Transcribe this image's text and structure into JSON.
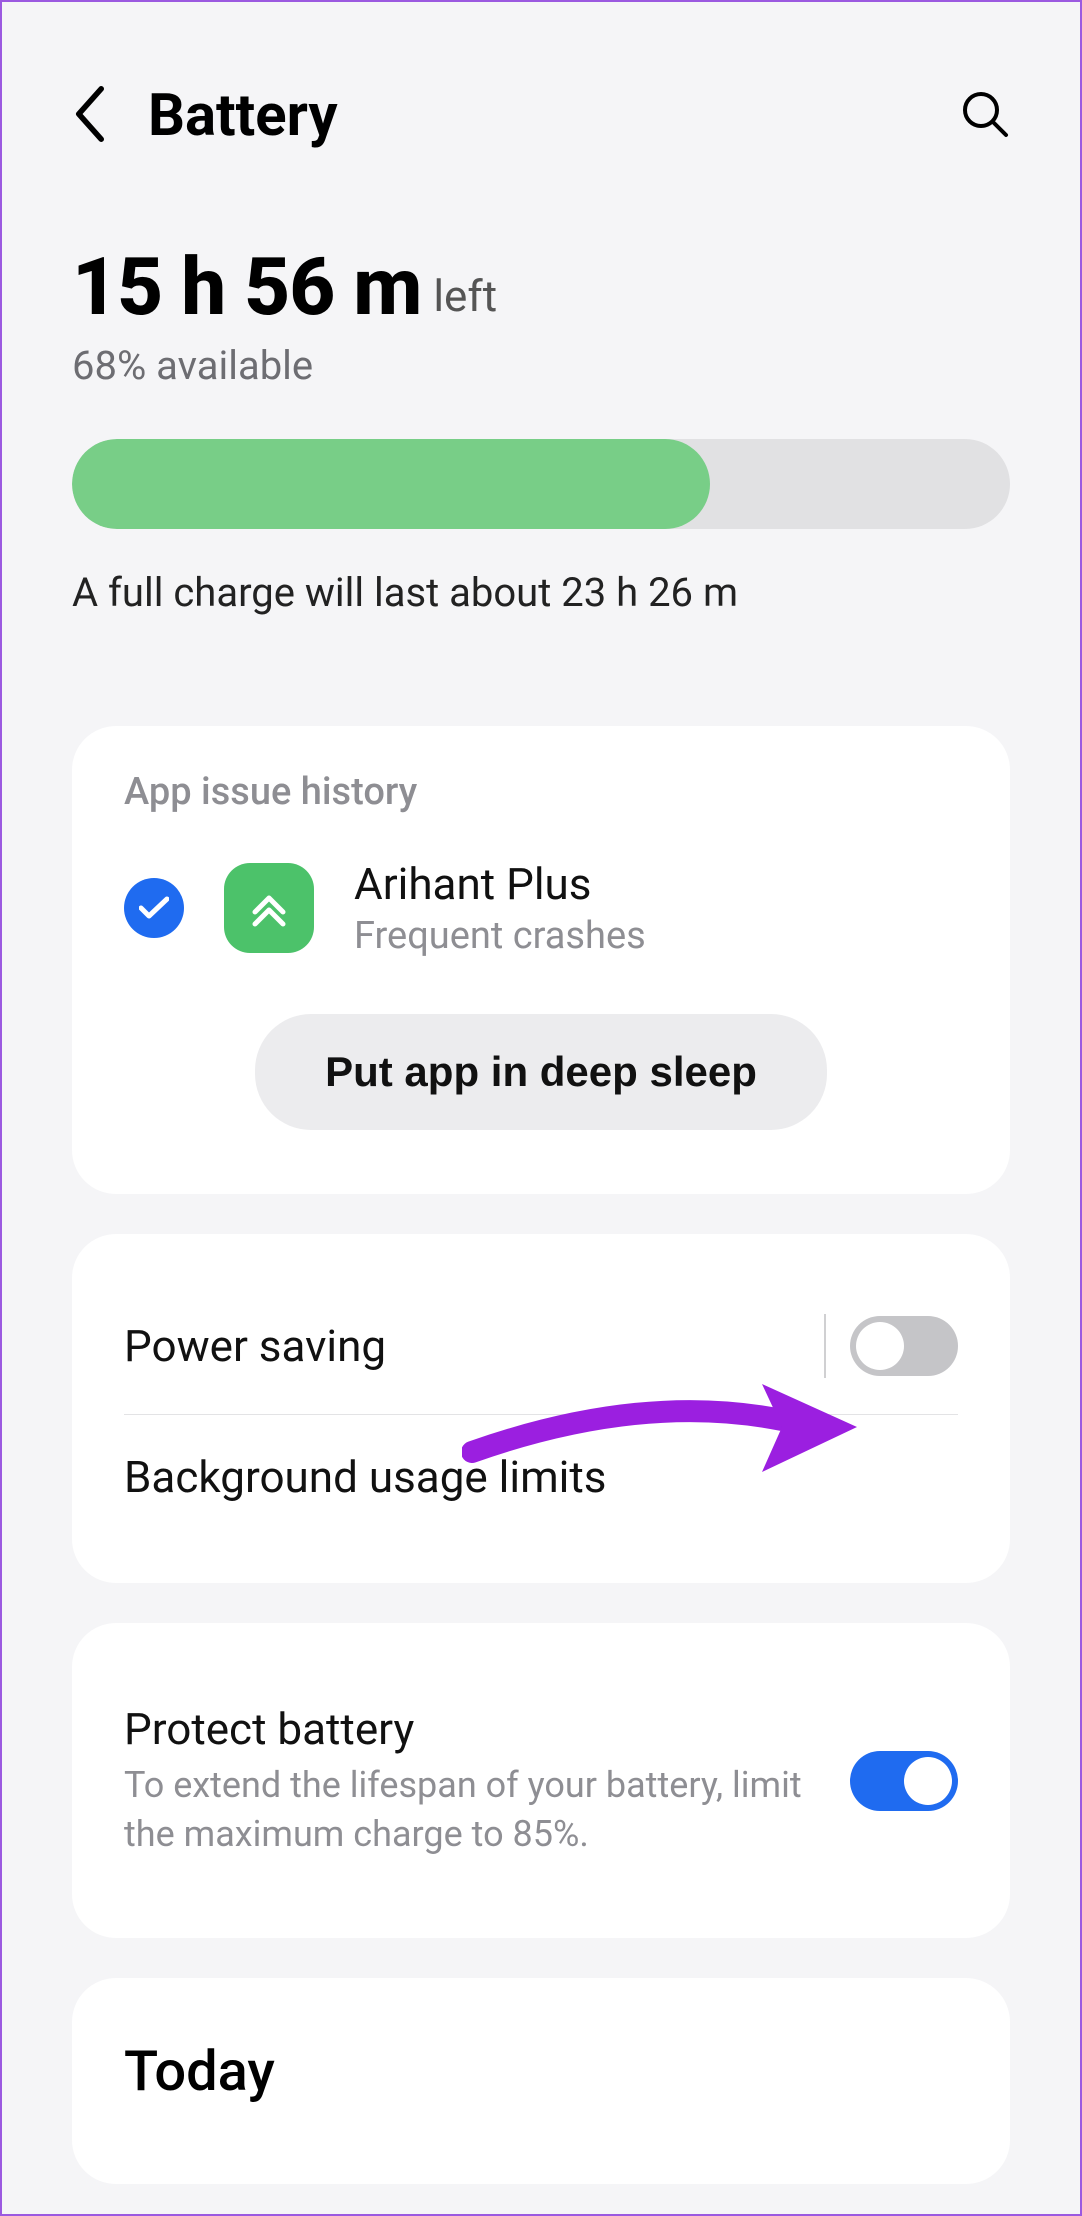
{
  "header": {
    "title": "Battery"
  },
  "battery": {
    "time_left": "15 h 56 m",
    "left_label": "left",
    "percent_available": "68% available",
    "percent_value": 68,
    "full_charge_estimate": "A full charge will last about 23 h 26 m"
  },
  "issue_history": {
    "section_title": "App issue history",
    "app_name": "Arihant Plus",
    "app_reason": "Frequent crashes",
    "deep_sleep_button": "Put app in deep sleep"
  },
  "settings": {
    "power_saving": {
      "label": "Power saving",
      "enabled": false
    },
    "background_limits": {
      "label": "Background usage limits"
    },
    "protect_battery": {
      "label": "Protect battery",
      "description": "To extend the lifespan of your battery, limit the maximum charge to 85%.",
      "enabled": true
    }
  },
  "today_section": {
    "title": "Today"
  },
  "colors": {
    "accent_blue": "#1f6bf0",
    "bar_green": "#78ce87",
    "annotation_purple": "#9b1fe0"
  }
}
